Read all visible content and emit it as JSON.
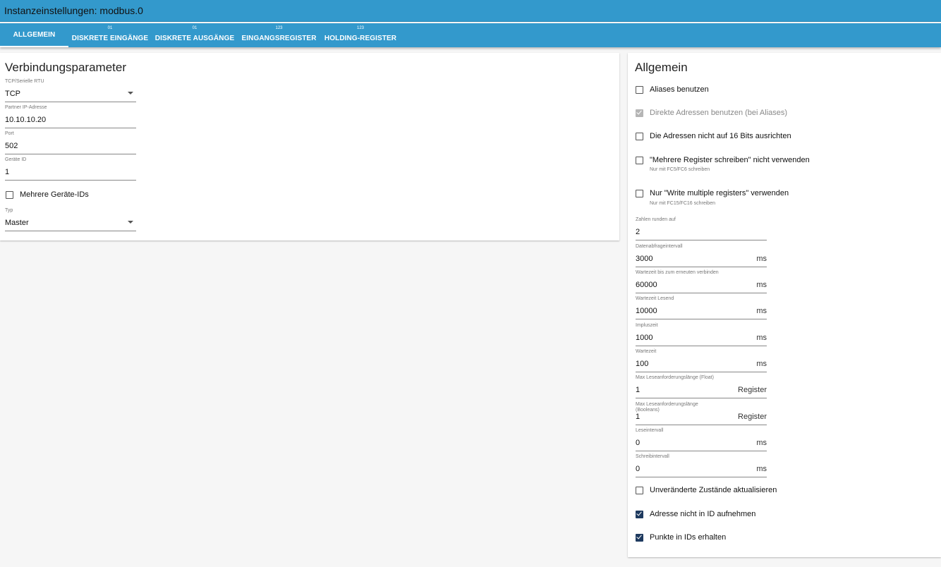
{
  "title": "Instanzeinstellungen: modbus.0",
  "tabs": [
    {
      "label": "ALLGEMEIN",
      "sup": ""
    },
    {
      "label": "DISKRETE EINGÄNGE",
      "sup": "01"
    },
    {
      "label": "DISKRETE AUSGÄNGE",
      "sup": "01"
    },
    {
      "label": "EINGANGSREGISTER",
      "sup": "123"
    },
    {
      "label": "HOLDING-REGISTER",
      "sup": "123"
    }
  ],
  "left": {
    "title": "Verbindungsparameter",
    "connection_type": {
      "label": "TCP/Serielle RTU",
      "value": "TCP"
    },
    "partner_ip": {
      "label": "Partner IP-Adresse",
      "value": "10.10.10.20"
    },
    "port": {
      "label": "Port",
      "value": "502"
    },
    "device_id": {
      "label": "Geräte ID",
      "value": "1"
    },
    "multiple_ids": {
      "label": "Mehrere Geräte-IDs",
      "checked": false
    },
    "type": {
      "label": "Typ",
      "value": "Master"
    }
  },
  "right": {
    "title": "Allgemein",
    "checks": {
      "aliases": {
        "label": "Aliases benutzen",
        "checked": false
      },
      "direct_addresses": {
        "label": "Direkte Adressen benutzen (bei Aliases)",
        "checked": true,
        "disabled": true
      },
      "align16": {
        "label": "Die Adressen nicht auf 16 Bits ausrichten",
        "checked": false
      },
      "no_multi_write": {
        "label": "\"Mehrere Register schreiben\" nicht verwenden",
        "hint": "Nur mit FC5/FC6 schreiben",
        "checked": false
      },
      "only_multi_write": {
        "label": "Nur \"Write multiple registers\" verwenden",
        "hint": "Nur mit FC15/FC16 schreiben",
        "checked": false
      },
      "update_unchanged": {
        "label": "Unveränderte Zustände aktualisieren",
        "checked": false
      },
      "no_address_in_id": {
        "label": "Adresse nicht in ID aufnehmen",
        "checked": true
      },
      "keep_dots": {
        "label": "Punkte in IDs erhalten",
        "checked": true
      }
    },
    "round": {
      "label": "Zahlen runden auf",
      "value": "2",
      "unit": ""
    },
    "poll": {
      "label": "Datenabfrageintervall",
      "value": "3000",
      "unit": "ms"
    },
    "reconnect": {
      "label": "Wartezeit bis zum erneuten verbinden",
      "value": "60000",
      "unit": "ms"
    },
    "read_timeout": {
      "label": "Wartezeit Lesend",
      "value": "10000",
      "unit": "ms"
    },
    "pulse": {
      "label": "Impluszeit",
      "value": "1000",
      "unit": "ms"
    },
    "wait": {
      "label": "Wartezeit",
      "value": "100",
      "unit": "ms"
    },
    "max_float": {
      "label": "Max Leseanforderungslänge (Float)",
      "value": "1",
      "unit": "Register"
    },
    "max_bool": {
      "label": "Max Leseanforderungslänge (Booleans)",
      "value": "1",
      "unit": "Register"
    },
    "read_interval": {
      "label": "Leseintervall",
      "value": "0",
      "unit": "ms"
    },
    "write_interval": {
      "label": "Schreibintervall",
      "value": "0",
      "unit": "ms"
    }
  }
}
